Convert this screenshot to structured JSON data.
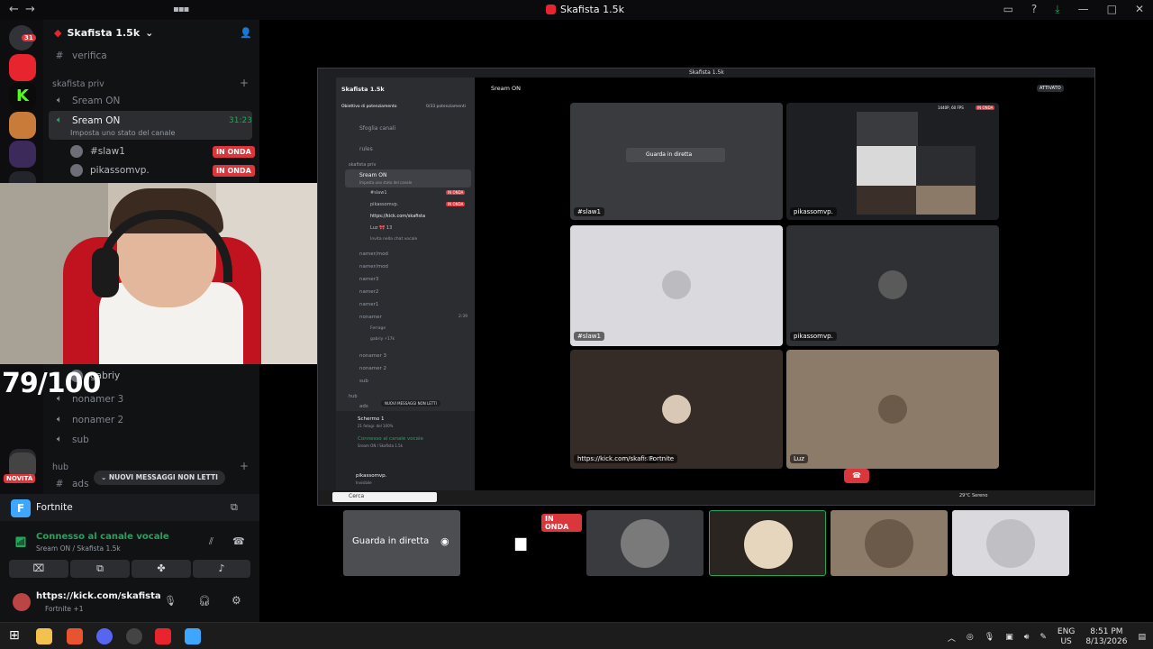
{
  "window": {
    "title": "Skafista 1.5k",
    "nav_back": "←",
    "nav_forward": "→"
  },
  "server": {
    "name": "Skafista 1.5k",
    "top_channel": "verifica",
    "category_priv": "skafista priv",
    "channels": [
      "Sream ON",
      "Sream ON"
    ],
    "active_channel": "Sream ON",
    "active_channel_time": "31:23",
    "active_status": "Imposta uno stato del canale",
    "members": [
      {
        "name": "#slaw1",
        "badge": "IN ONDA"
      },
      {
        "name": "pikassomvp.",
        "badge": "IN ONDA"
      }
    ],
    "lower_member": "gabriy",
    "voice_channels": [
      "nonamer 3",
      "nonamer 2",
      "sub"
    ],
    "category_hub": "hub",
    "hub_channel": "ads",
    "new_messages": "NUOVI MESSAGGI NON LETTI",
    "novita": "NOVITÀ",
    "rail_badge_top": "31",
    "rail_badge_low": "1"
  },
  "overlay": {
    "score": "79/100"
  },
  "voice_panel": {
    "activity": "Fortnite",
    "connected": "Connesso al canale vocale",
    "connected_sub": "Sream ON / Skafista 1.5k",
    "user": "https://kick.com/skafista",
    "user_status": "Fortnite +1"
  },
  "inner": {
    "title": "Skafista 1.5k",
    "server_name": "Skafista 1.5k",
    "boost": "Obiettivo di potenziamento",
    "boost_count": "0/33 potenziamenti",
    "browse": "Sfoglia canali",
    "rules": "rules",
    "cat": "skafista priv",
    "channel": "Sream ON",
    "channel_status": "Imposta uno stato del canale",
    "members": [
      "#slaw1",
      "pikassomvp.",
      "https://kick.com/skafista",
      "Luz 🎀 13"
    ],
    "invite": "Invita nella chat vocale",
    "channels2": [
      "namer/mod",
      "namer/mod",
      "namer3",
      "namer2",
      "namer1",
      "nonamer"
    ],
    "nonamer_time": "2:39",
    "sub_members": [
      "Ferrage",
      "gabriy ⚡17k"
    ],
    "channels3": [
      "nonamer 3",
      "nonamer 2",
      "sub"
    ],
    "hub": "hub",
    "ads": "ads",
    "new_msgs": "NUOVI MESSAGGI NON LETTI",
    "screen": "Schermo 1",
    "screen_sub": "21 fotogr. del 100%",
    "connected": "Connesso al canale vocale",
    "connected_sub": "Sream ON / Skafista 1.5k",
    "user": "pikassomvp.",
    "user_sub": "Invisibile",
    "header_channel": "Sream ON",
    "attivato": "ATTIVATO",
    "watch": "Guarda in diretta",
    "stats": "1440P, 60 FPS",
    "in_onda": "IN ONDA",
    "tile_labels": [
      "#slaw1",
      "pikassomvp.",
      "#slaw1",
      "pikassomvp.",
      "https://kick.com/skafista",
      "Fortnite",
      "Luz"
    ],
    "search": "Cerca",
    "weather": "29°C  Sereno"
  },
  "strip": {
    "watch": "Guarda in diretta",
    "live": "IN ONDA"
  },
  "taskbar": {
    "lang": "ENG",
    "region": "US",
    "time": "8:51 PM",
    "date": "8/13/2026"
  },
  "colors": {
    "live_red": "#da373c",
    "discord_green": "#23a55a",
    "accent": "#5865f2"
  }
}
